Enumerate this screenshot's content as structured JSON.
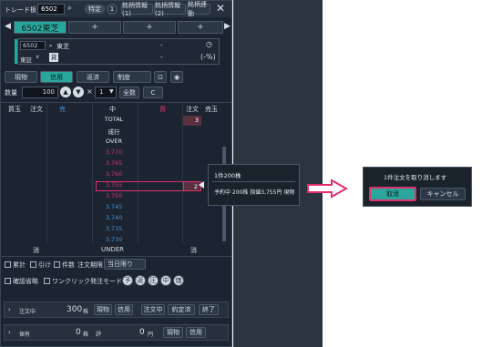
{
  "header": {
    "title": "トレード板",
    "code": "6502",
    "tags": [
      "特定",
      "1",
      "銘柄情報(1)",
      "銘柄情報(2)",
      "銘柄連動"
    ]
  },
  "tabs": [
    "6502東芝",
    "+",
    "+",
    "+"
  ],
  "stock": {
    "code": "6502",
    "name": "東芝",
    "market": "東証",
    "badge": "貸",
    "dash1": "-",
    "dash2": "-",
    "pct": "(-%)"
  },
  "mode": {
    "buttons": [
      "現物",
      "信用",
      "返済"
    ],
    "select": "制度"
  },
  "qty": {
    "label": "数量",
    "value": "100",
    "mult": "1",
    "all": "全数",
    "clear": "C"
  },
  "table": {
    "headers": [
      "買玉",
      "注文",
      "売",
      "中",
      "買",
      "注文",
      "売玉"
    ]
  },
  "rows": [
    {
      "price": "TOTAL",
      "right": "3",
      "style": "white"
    },
    {
      "price": "成行",
      "right": "",
      "style": "white"
    },
    {
      "price": "OVER",
      "right": "",
      "style": "white"
    },
    {
      "price": "3,770",
      "right": "",
      "style": "red"
    },
    {
      "price": "3,765",
      "right": "",
      "style": "red"
    },
    {
      "price": "3,760",
      "right": "",
      "style": "red"
    },
    {
      "price": "3,755",
      "right": "2",
      "style": "red"
    },
    {
      "price": "3,750",
      "right": "",
      "style": "red"
    },
    {
      "price": "3,745",
      "right": "",
      "style": "blue"
    },
    {
      "price": "3,740",
      "right": "",
      "style": "blue"
    },
    {
      "price": "3,735",
      "right": "",
      "style": "blue"
    },
    {
      "price": "3,730",
      "right": "",
      "style": "blue"
    }
  ],
  "footer_row": {
    "left": "消",
    "mid": "UNDER",
    "right": "消"
  },
  "options": {
    "c1": "累計",
    "c2": "引け",
    "c3": "件数",
    "expiry": "注文期限",
    "expiry_val": "当日限り"
  },
  "options2": {
    "c1": "確認省略",
    "c2": "ワンクリック発注モード",
    "circles": [
      "予",
      "返",
      "圧",
      "中",
      "価"
    ]
  },
  "bottom1": {
    "label": "注文中",
    "value": "300",
    "unit": "株",
    "buttons": [
      "現物",
      "信用",
      "注文中",
      "約定済",
      "終了"
    ]
  },
  "bottom2": {
    "label": "保有",
    "value": "0",
    "unit": "株",
    "eval_label": "評",
    "eval_val": "0",
    "eval_unit": "円",
    "buttons": [
      "現物",
      "信用"
    ]
  },
  "tooltip": {
    "title": "1件200株",
    "detail": "予約中 200株 指値3,755円 現物"
  },
  "dialog": {
    "title": "1件注文を取り消します",
    "cancel": "取消",
    "back": "キャンセル"
  },
  "colors": {
    "accent": "#2aa79c",
    "highlight": "#e0306a"
  }
}
